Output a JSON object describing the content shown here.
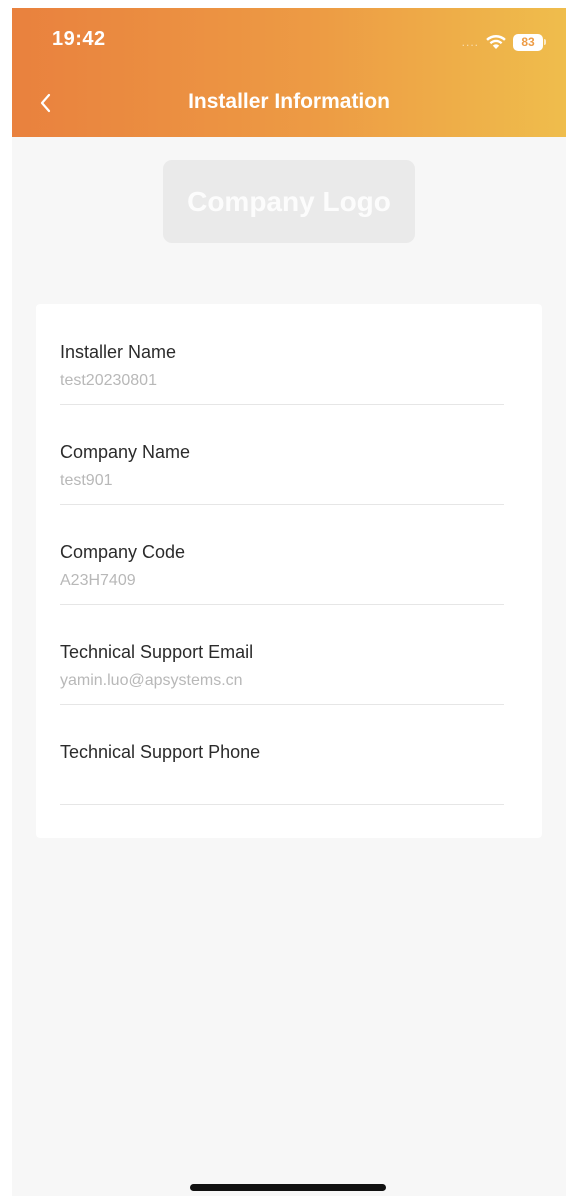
{
  "status_bar": {
    "time": "19:42",
    "signal": "....",
    "battery": "83"
  },
  "header": {
    "title": "Installer Information",
    "back_icon": "chevron-left-icon"
  },
  "logo": {
    "text": "Company Logo"
  },
  "fields": [
    {
      "label": "Installer Name",
      "value": "test20230801"
    },
    {
      "label": "Company Name",
      "value": "test901"
    },
    {
      "label": "Company Code",
      "value": "A23H7409"
    },
    {
      "label": "Technical Support Email",
      "value": "yamin.luo@apsystems.cn"
    },
    {
      "label": "Technical Support Phone",
      "value": ""
    }
  ],
  "colors": {
    "header_start": "#e9813e",
    "header_end": "#efbd4c",
    "background": "#f7f7f7",
    "value_text": "#b8b8b8"
  }
}
